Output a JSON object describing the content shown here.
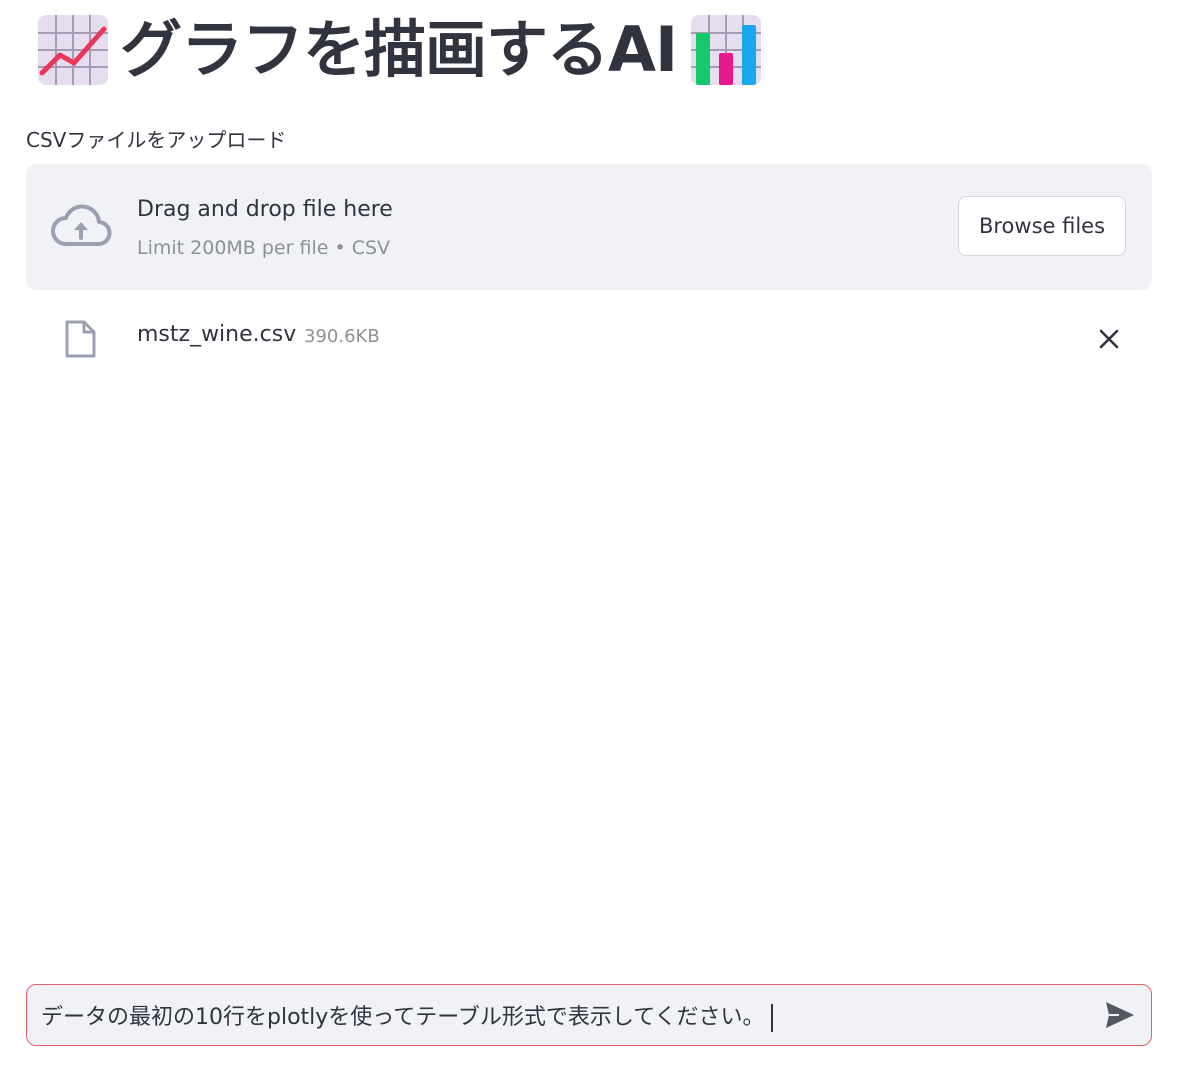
{
  "header": {
    "title": "グラフを描画するAI",
    "icons": [
      "chart-increasing-icon",
      "bar-chart-icon"
    ]
  },
  "uploader": {
    "label": "CSVファイルをアップロード",
    "instructions": "Drag and drop file here",
    "limit": "Limit 200MB per file • CSV",
    "browse_label": "Browse files"
  },
  "uploaded_file": {
    "name": "mstz_wine.csv",
    "size": "390.6KB"
  },
  "chat": {
    "value": "データの最初の10行をplotlyを使ってテーブル形式で表示してください。"
  },
  "colors": {
    "text": "#31333f",
    "muted": "#8d9096",
    "panel": "#f0f2f6",
    "focus_border": "#e0656a",
    "emoji_tile": "#e6deef",
    "trend_line": "#e8375a",
    "bar_green": "#14c96b",
    "bar_pink": "#e9178d",
    "bar_blue": "#1aa7ec"
  }
}
